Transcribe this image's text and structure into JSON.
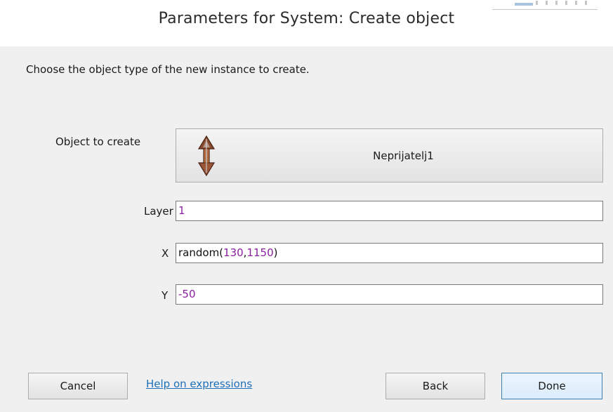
{
  "dialog": {
    "title": "Parameters for System: Create object",
    "instruction": "Choose the object type of the new instance to create."
  },
  "params": {
    "object_label": "Object to create",
    "object_value": "Neprijatelj1",
    "object_icon": "sprite-icon",
    "layer_label": "Layer",
    "layer_value": "1",
    "x_label": "X",
    "x_fn": "random(",
    "x_arg1": "130",
    "x_comma": ",",
    "x_arg2": "1150",
    "x_close": ")",
    "y_label": "Y",
    "y_value": "-50"
  },
  "footer": {
    "cancel_label": "Cancel",
    "help_label": "Help on expressions",
    "back_label": "Back",
    "done_label": "Done"
  },
  "colors": {
    "number_token": "#8b1fa0",
    "link": "#1d6fb8",
    "primary_border": "#3c7fb1"
  }
}
